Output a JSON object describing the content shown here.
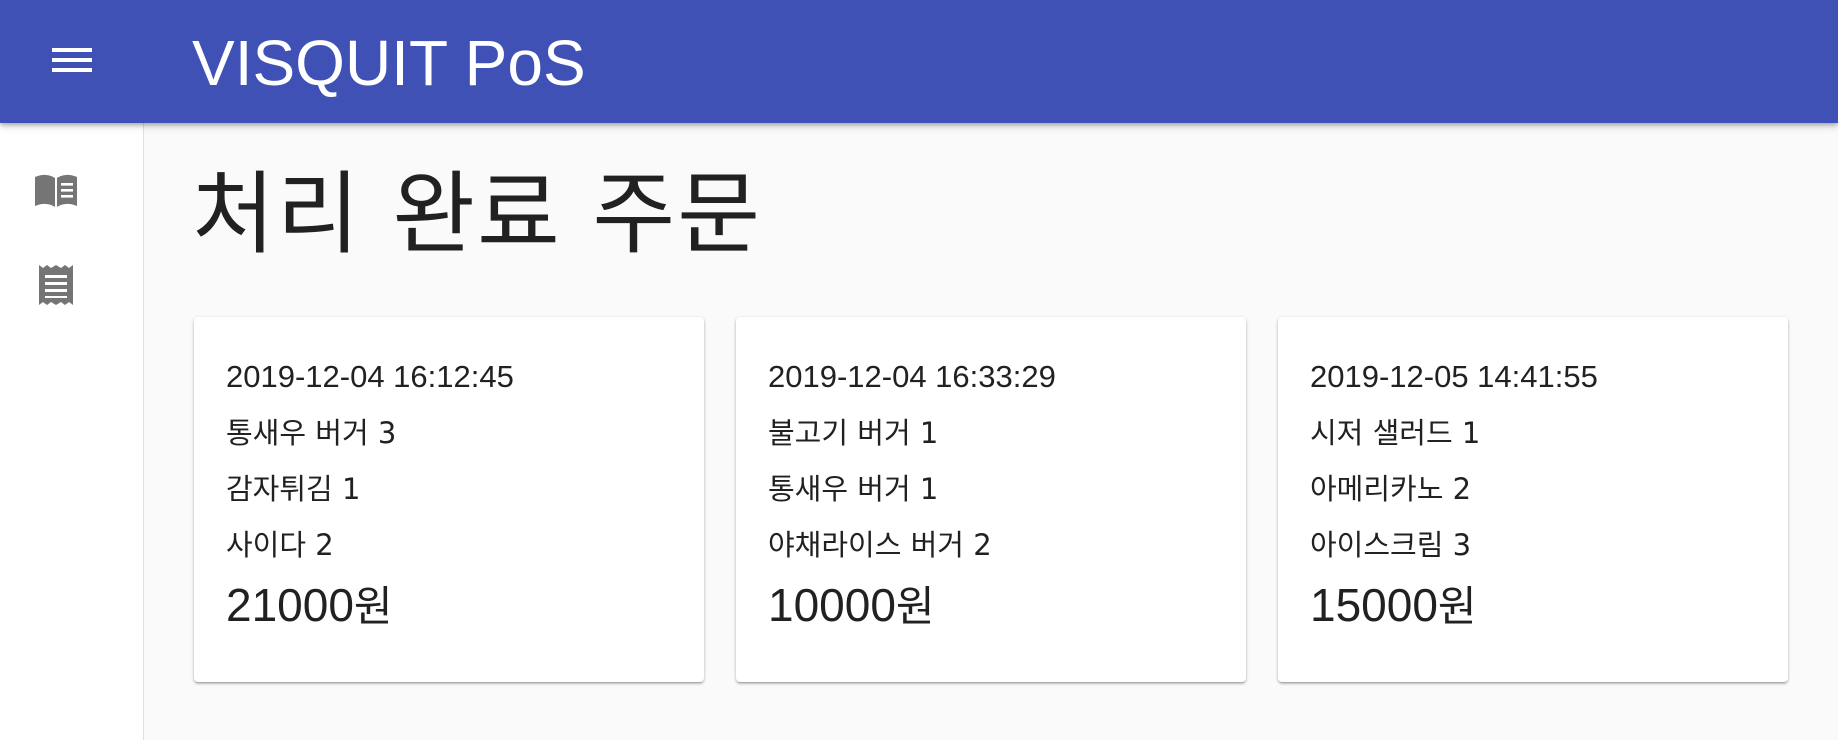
{
  "app": {
    "title": "VISQUIT PoS",
    "accent_color": "#3f51b5"
  },
  "sidebar": {
    "items": [
      {
        "icon": "book-icon"
      },
      {
        "icon": "receipt-icon"
      }
    ]
  },
  "page": {
    "title": "처리 완료 주문"
  },
  "orders": [
    {
      "datetime": "2019-12-04 16:12:45",
      "items": [
        "통새우 버거 3",
        "감자튀김 1",
        "사이다 2"
      ],
      "total_amount": "21000",
      "total_unit": "원"
    },
    {
      "datetime": "2019-12-04 16:33:29",
      "items": [
        "불고기 버거 1",
        "통새우 버거 1",
        "야채라이스 버거 2"
      ],
      "total_amount": "10000",
      "total_unit": "원"
    },
    {
      "datetime": "2019-12-05 14:41:55",
      "items": [
        "시저 샐러드 1",
        "아메리카노 2",
        "아이스크림 3"
      ],
      "total_amount": "15000",
      "total_unit": "원"
    }
  ]
}
